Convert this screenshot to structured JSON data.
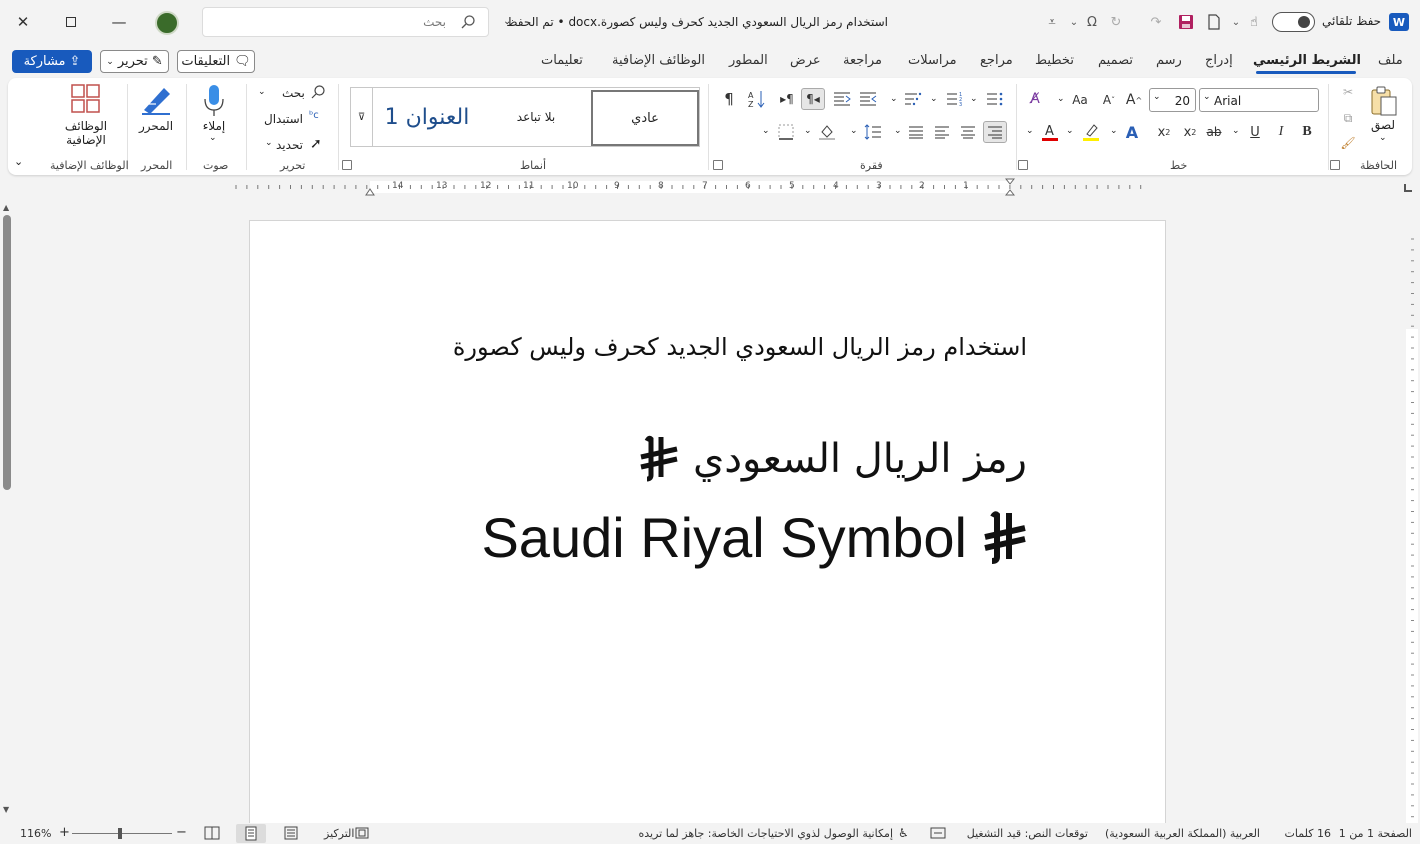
{
  "titlebar": {
    "doc_title": "استخدام رمز الريال السعودي الجديد كحرف وليس كصورة.docx • تم الحفظ",
    "search_placeholder": "بحث",
    "autosave_label": "حفظ تلقائي",
    "autosave_state": "off",
    "app_icon": "W"
  },
  "tabs": {
    "items": [
      "ملف",
      "الشريط الرئيسي",
      "إدراج",
      "رسم",
      "تصميم",
      "تخطيط",
      "مراجع",
      "مراسلات",
      "مراجعة",
      "عرض",
      "المطور",
      "الوظائف الإضافية",
      "تعليمات"
    ],
    "active": "الشريط الرئيسي",
    "share_label": "مشاركة",
    "edit_label": "تحرير",
    "comments_label": "التعليقات"
  },
  "ribbon": {
    "clipboard": {
      "label": "الحافظة",
      "paste_label": "لصق"
    },
    "font": {
      "label": "خط",
      "font_name": "Arial",
      "font_size": "20",
      "change_case": "Aa"
    },
    "paragraph": {
      "label": "فقرة"
    },
    "styles": {
      "label": "أنماط",
      "normal": "عادي",
      "no_spacing": "بلا تباعد",
      "heading1": "العنوان 1"
    },
    "editing": {
      "label": "تحرير",
      "find": "بحث",
      "replace": "استبدال",
      "select": "تحديد"
    },
    "voice": {
      "label": "صوت",
      "dictate": "إملاء"
    },
    "editor": {
      "label": "المحرر",
      "editor_btn": "المحرر"
    },
    "addins": {
      "label": "الوظائف الإضافية",
      "addins_btn_line1": "الوظائف",
      "addins_btn_line2": "الإضافية"
    }
  },
  "ruler": {
    "numbers": [
      "1",
      "2",
      "3",
      "4",
      "5",
      "6",
      "7",
      "8",
      "9",
      "10",
      "11",
      "12",
      "13",
      "14"
    ]
  },
  "document": {
    "line1": "استخدام رمز الريال السعودي الجديد كحرف وليس كصورة",
    "line2": "رمز الريال السعودي",
    "line3": "Saudi Riyal Symbol"
  },
  "statusbar": {
    "page": "الصفحة 1 من 1",
    "words": "16 كلمات",
    "language": "العربية (المملكة العربية السعودية)",
    "predictions": "توقعات النص: قيد التشغيل",
    "accessibility": "إمكانية الوصول لذوي الاحتياجات الخاصة: جاهز لما تريده",
    "focus": "التركيز",
    "zoom": "116%"
  },
  "colors": {
    "accent": "#185abd",
    "font_color": "#e00000",
    "highlight": "#ffef00",
    "save_icon": "#b02060"
  }
}
